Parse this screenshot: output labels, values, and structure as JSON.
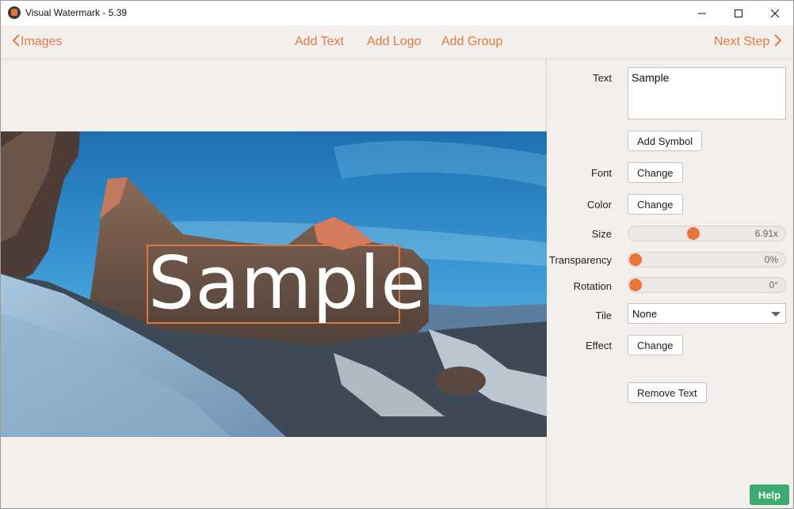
{
  "window": {
    "title": "Visual Watermark - 5.39"
  },
  "nav": {
    "back_label": "Images",
    "add_text": "Add Text",
    "add_logo": "Add Logo",
    "add_group": "Add Group",
    "next_label": "Next Step"
  },
  "preview": {
    "watermark_text": "Sample"
  },
  "panel": {
    "text_label": "Text",
    "text_value": "Sample",
    "add_symbol": "Add Symbol",
    "font_label": "Font",
    "font_button": "Change",
    "color_label": "Color",
    "color_button": "Change",
    "size_label": "Size",
    "size_value": "6.91x",
    "transparency_label": "Transparency",
    "transparency_value": "0%",
    "rotation_label": "Rotation",
    "rotation_value": "0°",
    "tile_label": "Tile",
    "tile_value": "None",
    "effect_label": "Effect",
    "effect_button": "Change",
    "remove_text": "Remove Text"
  },
  "sliders": {
    "size_fraction": 0.405,
    "transparency_fraction": 0.0,
    "rotation_fraction": 0.0
  },
  "help": "Help",
  "icons": {
    "app": "app-logo-icon",
    "minimize": "minimize-icon",
    "maximize": "maximize-icon",
    "close": "close-icon",
    "back": "chevron-left-icon",
    "next": "chevron-right-icon",
    "dropdown": "chevron-down-icon"
  },
  "colors": {
    "accent": "#e07a44",
    "slider_knob": "#e8743b",
    "help": "#3daa70",
    "background": "#f3efed"
  }
}
